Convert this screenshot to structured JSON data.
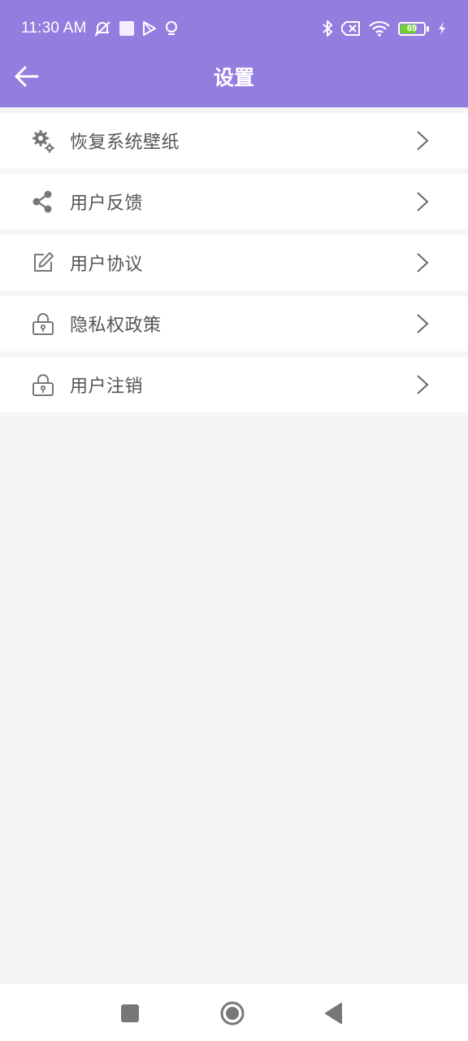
{
  "status_bar": {
    "time": "11:30 AM",
    "battery_level": "69",
    "battery_fraction": 0.69,
    "left_icons": [
      "mute-icon",
      "square-notification-icon",
      "play-store-icon",
      "bulb-icon"
    ],
    "right_icons": [
      "bluetooth-icon",
      "no-sim-icon",
      "wifi-icon",
      "battery-icon",
      "charging-icon"
    ]
  },
  "header": {
    "title": "设置",
    "background": "#937ee0"
  },
  "settings": {
    "items": [
      {
        "label": "恢复系统壁纸",
        "icon": "gears-icon"
      },
      {
        "label": "用户反馈",
        "icon": "share-icon"
      },
      {
        "label": "用户协议",
        "icon": "edit-icon"
      },
      {
        "label": "隐私权政策",
        "icon": "lock-icon"
      },
      {
        "label": "用户注销",
        "icon": "lock-icon"
      }
    ]
  },
  "nav_bar": {
    "buttons": [
      "recents-button",
      "home-button",
      "back-button"
    ]
  }
}
